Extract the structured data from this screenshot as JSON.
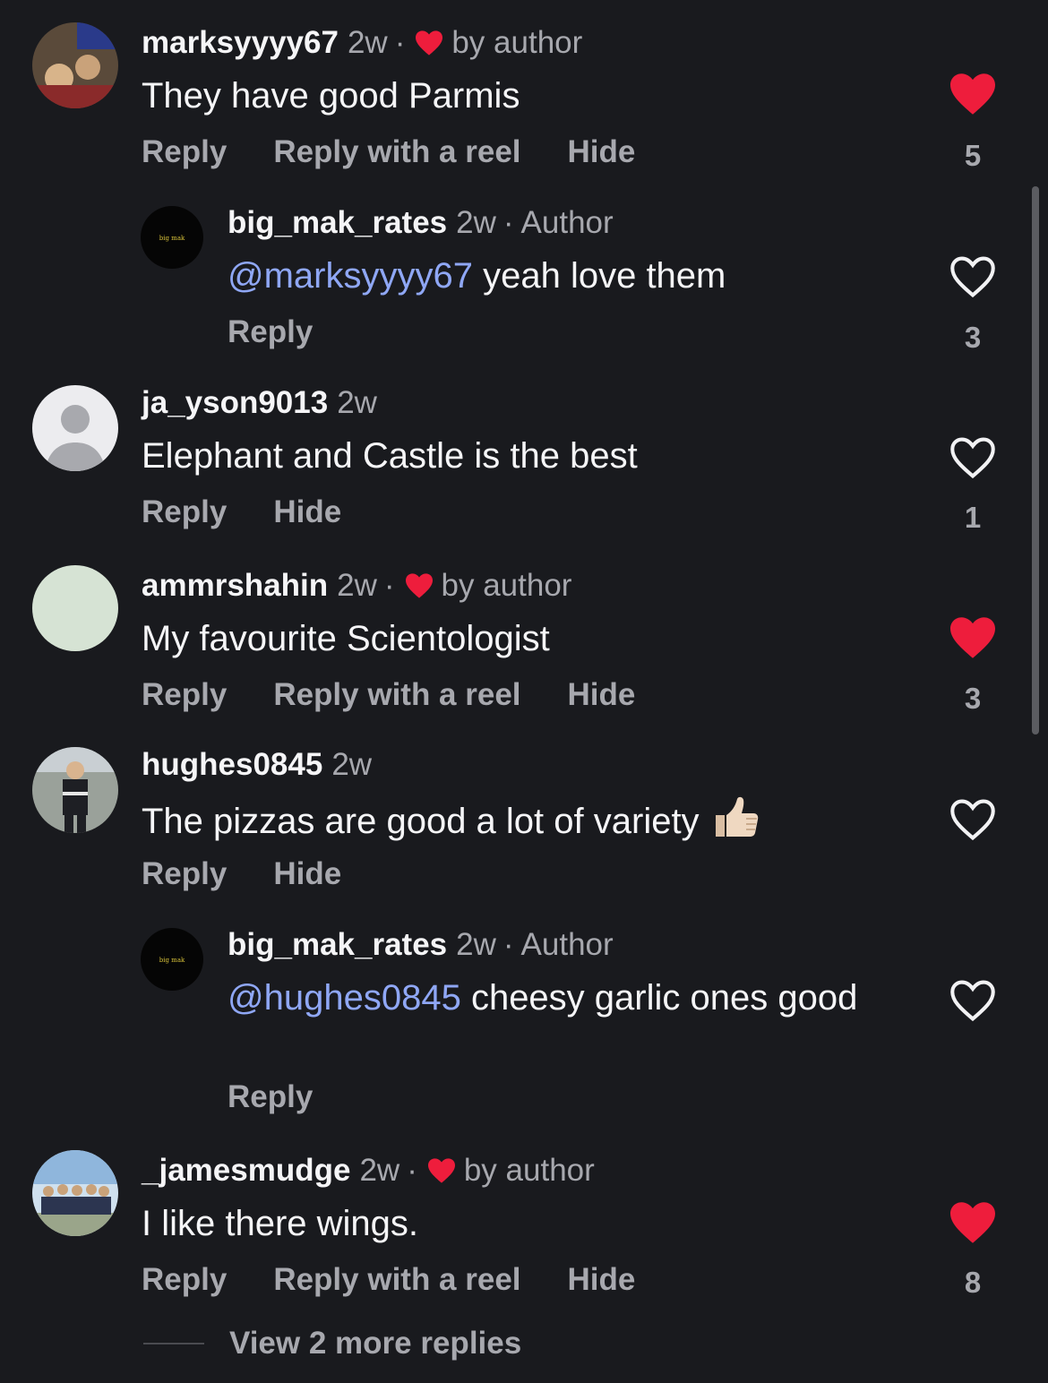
{
  "colors": {
    "background": "#191a1e",
    "mention": "#8fa7f5",
    "liked": "#ee1d3c",
    "muted": "#a7a8ae"
  },
  "comments": [
    {
      "username": "marksyyyy67",
      "time": "2w",
      "sep": "·",
      "by_author": "by author",
      "text": "They have good Parmis",
      "actions": [
        "Reply",
        "Reply with a reel",
        "Hide"
      ],
      "likes": "5",
      "liked": true
    },
    {
      "username": "big_mak_rates",
      "time": "2w",
      "sep": "·",
      "author_tag": "Author",
      "mention": "@marksyyyy67",
      "text": " yeah love them",
      "actions": [
        "Reply"
      ],
      "likes": "3",
      "liked": false,
      "avatar_text": "big mak"
    },
    {
      "username": "ja_yson9013",
      "time": "2w",
      "text": "Elephant and Castle is the best",
      "actions": [
        "Reply",
        "Hide"
      ],
      "likes": "1",
      "liked": false
    },
    {
      "username": "ammrshahin",
      "time": "2w",
      "sep": "·",
      "by_author": "by author",
      "text": "My favourite Scientologist",
      "actions": [
        "Reply",
        "Reply with a reel",
        "Hide"
      ],
      "likes": "3",
      "liked": true
    },
    {
      "username": "hughes0845",
      "time": "2w",
      "text": "The pizzas are good a lot of variety",
      "emoji": "thumbs-up-icon",
      "actions": [
        "Reply",
        "Hide"
      ],
      "liked": false
    },
    {
      "username": "big_mak_rates",
      "time": "2w",
      "sep": "·",
      "author_tag": "Author",
      "mention": "@hughes0845",
      "text": " cheesy garlic ones good",
      "actions": [
        "Reply"
      ],
      "liked": false,
      "avatar_text": "big mak"
    },
    {
      "username": "_jamesmudge",
      "time": "2w",
      "sep": "·",
      "by_author": "by author",
      "text": "I like there wings.",
      "actions": [
        "Reply",
        "Reply with a reel",
        "Hide"
      ],
      "likes": "8",
      "liked": true
    }
  ],
  "view_more": "View 2 more replies"
}
